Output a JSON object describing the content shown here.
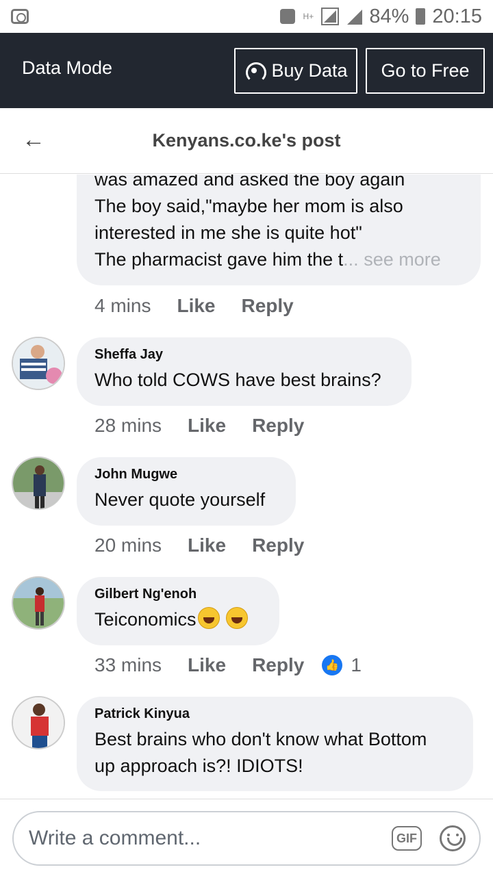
{
  "status_bar": {
    "network": "H+",
    "battery": "84%",
    "time": "20:15"
  },
  "data_bar": {
    "label": "Data Mode",
    "buy_data": "Buy Data",
    "go_free": "Go to Free"
  },
  "header": {
    "title": "Kenyans.co.ke's post"
  },
  "comments": [
    {
      "lines": [
        "was amazed and asked the boy again",
        "The boy said,\"maybe her mom is also",
        "interested in me she is quite hot\"",
        "The pharmacist gave him the t"
      ],
      "ellipsis": "...",
      "see_more": "see more",
      "time": "4 mins",
      "like": "Like",
      "reply": "Reply"
    },
    {
      "name": "Sheffa Jay",
      "text": "Who told COWS have best brains?",
      "time": "28 mins",
      "like": "Like",
      "reply": "Reply"
    },
    {
      "name": "John Mugwe",
      "text": "Never quote yourself",
      "time": "20 mins",
      "like": "Like",
      "reply": "Reply"
    },
    {
      "name": "Gilbert Ng'enoh",
      "text": "Teiconomics",
      "emoji": "laughing-emoji",
      "time": "33 mins",
      "like": "Like",
      "reply": "Reply",
      "reaction_count": "1"
    },
    {
      "name": "Patrick Kinyua",
      "text_line1": "Best brains who don't know what Bottom",
      "text_line2": "up approach is?! IDIOTS!"
    }
  ],
  "composer": {
    "placeholder": "Write a comment...",
    "gif_label": "GIF"
  },
  "colors": {
    "data_bar_bg": "#222730",
    "bubble_bg": "#f0f1f4",
    "like_blue": "#1877f2"
  }
}
